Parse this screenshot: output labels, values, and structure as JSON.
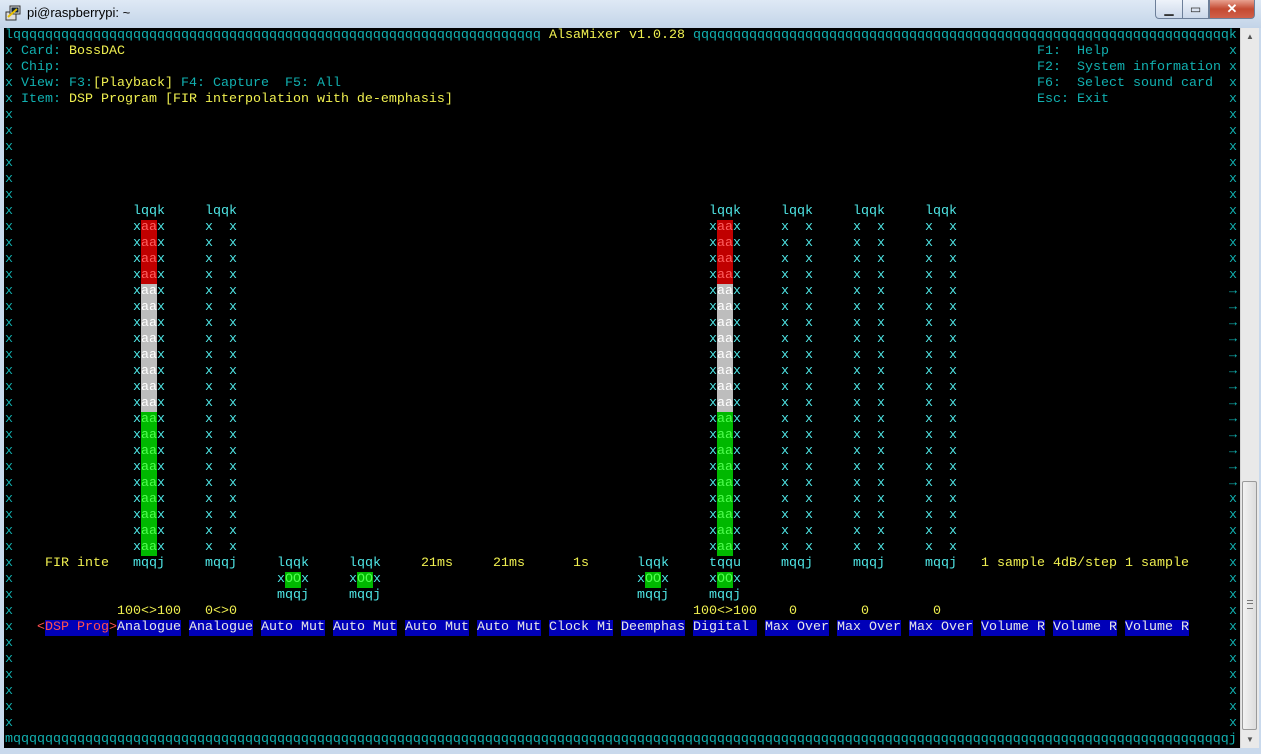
{
  "window": {
    "title": "pi@raspberrypi: ~",
    "minimize_label": "▁",
    "maximize_label": "▭",
    "close_label": "✕"
  },
  "terminal": {
    "border": {
      "tl": "l",
      "tr": "k",
      "bl": "m",
      "br": "j",
      "h": "q",
      "v": "x",
      "marker": "→"
    },
    "title": " AlsaMixer v1.0.28 ",
    "info": {
      "card_label": "Card:",
      "card_value": "BossDAC",
      "chip_label": "Chip:",
      "chip_value": "",
      "view_label": "View:",
      "view_f3": "F3:",
      "view_playback": "[Playback]",
      "view_f4": "F4: Capture",
      "view_f5": "F5: All",
      "item_label": "Item:",
      "item_value": "DSP Program [FIR interpolation with de-emphasis]"
    },
    "keys": [
      {
        "key": "F1:",
        "label": "Help"
      },
      {
        "key": "F2:",
        "label": "System information"
      },
      {
        "key": "F6:",
        "label": "Select sound card"
      },
      {
        "key": "Esc:",
        "label": "Exit"
      }
    ]
  },
  "glyphs": {
    "bar_top": "lqqk",
    "bar_bottom": "mqqj",
    "bar_join": "tqqu",
    "side": "x",
    "fill": "aa",
    "empty": "  ",
    "switch_on": "OO",
    "sel_left": "<",
    "sel_right": ">"
  },
  "mixer": {
    "selected_index": 0,
    "controls": [
      {
        "name": "DSP Prog",
        "type": "enum",
        "value": "FIR inte"
      },
      {
        "name": "Analogue",
        "type": "volume",
        "level_percent": 100,
        "value": "100<>100"
      },
      {
        "name": "Analogue",
        "type": "volume",
        "level_percent": 0,
        "value": "0<>0"
      },
      {
        "name": "Auto Mut",
        "type": "switch",
        "on": true
      },
      {
        "name": "Auto Mut",
        "type": "switch",
        "on": true
      },
      {
        "name": "Auto Mut",
        "type": "enum",
        "value": "21ms"
      },
      {
        "name": "Auto Mut",
        "type": "enum",
        "value": "21ms"
      },
      {
        "name": "Clock Mi",
        "type": "enum",
        "value": "1s"
      },
      {
        "name": "Deemphas",
        "type": "switch",
        "on": true
      },
      {
        "name": "Digital",
        "type": "volume_switch",
        "level_percent": 100,
        "value": "100<>100",
        "on": true
      },
      {
        "name": "Max Over",
        "type": "volume",
        "level_percent": 0,
        "value": "0"
      },
      {
        "name": "Max Over",
        "type": "volume",
        "level_percent": 0,
        "value": "0"
      },
      {
        "name": "Max Over",
        "type": "volume",
        "level_percent": 0,
        "value": "0"
      },
      {
        "name": "Volume R",
        "type": "enum",
        "value": "1 sample"
      },
      {
        "name": "Volume R",
        "type": "enum",
        "value": "4dB/step"
      },
      {
        "name": "Volume R",
        "type": "enum",
        "value": "1 sample"
      }
    ]
  },
  "colors": {
    "frame": "#11b0b0",
    "value": "#f0f050",
    "name_bg": "#0000b8",
    "bar_red": "#c00000",
    "bar_white": "#bdbdbd",
    "bar_green": "#00b800"
  }
}
